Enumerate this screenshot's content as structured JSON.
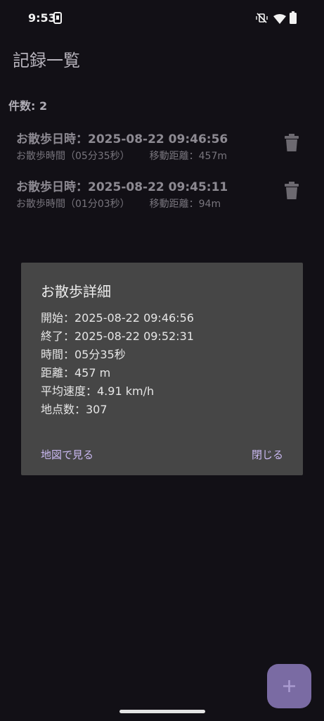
{
  "status_bar": {
    "time": "9:53",
    "icons": [
      "screen-record-icon",
      "mute-vibrate-icon",
      "wifi-icon",
      "battery-icon"
    ]
  },
  "page_title": "記録一覧",
  "count_text": "件数: 2",
  "records": [
    {
      "title": "お散歩日時：2025-08-22 09:46:56",
      "duration": "お散歩時間（05分35秒）",
      "distance": "移動距離：457m"
    },
    {
      "title": "お散歩日時：2025-08-22 09:45:11",
      "duration": "お散歩時間（01分03秒）",
      "distance": "移動距離：94m"
    }
  ],
  "dialog": {
    "title": "お散歩詳細",
    "lines": [
      "開始：2025-08-22 09:46:56",
      "終了：2025-08-22 09:52:31",
      "時間：05分35秒",
      "距離：457 m",
      "平均速度：4.91 km/h",
      "地点数：307"
    ],
    "map_button": "地図で見る",
    "close_button": "閉じる"
  },
  "fab_icon": "plus-icon",
  "colors": {
    "accent": "#c9b8f0",
    "fab": "#7a6ba3",
    "dialog_bg": "#464646",
    "background": "#121016"
  }
}
